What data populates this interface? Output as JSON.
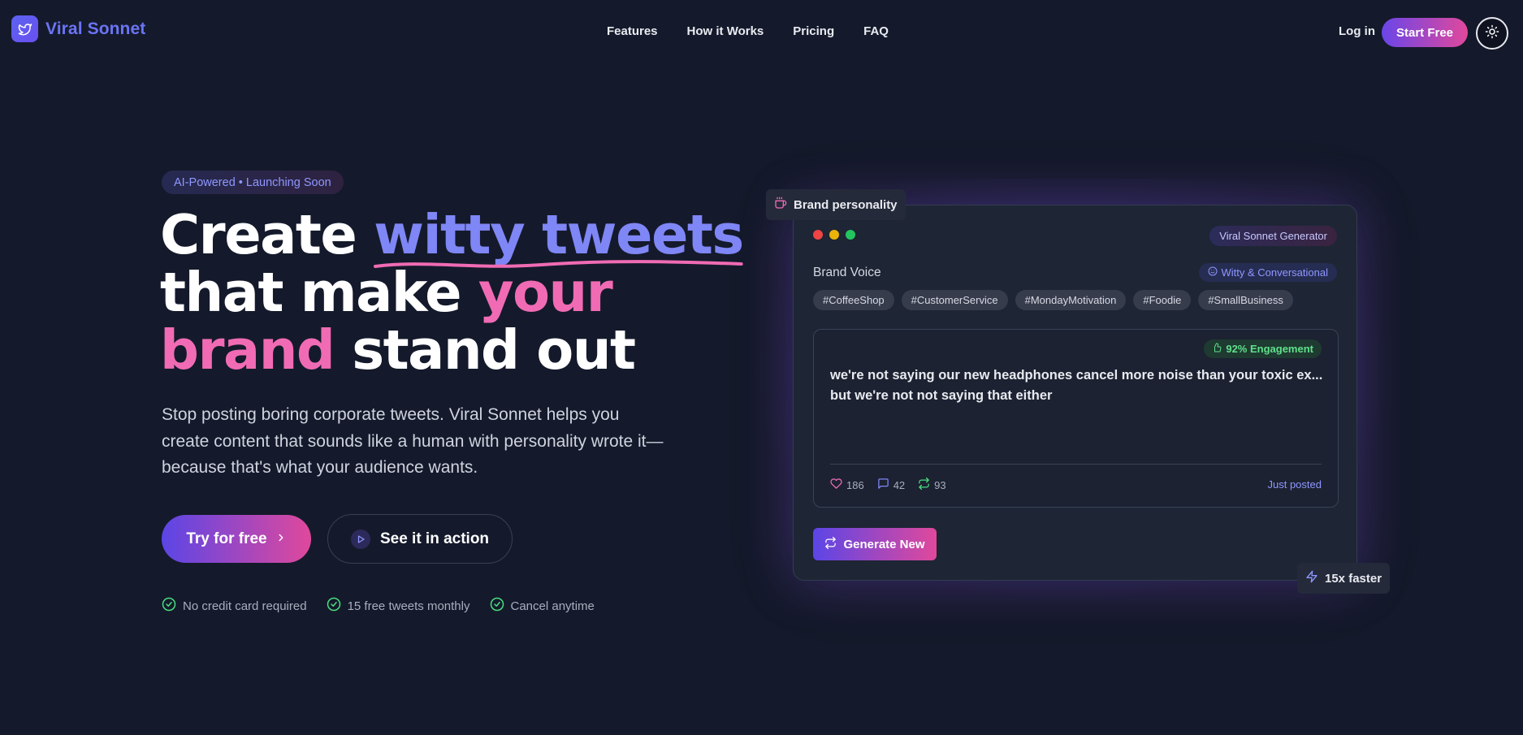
{
  "brand": {
    "name": "Viral Sonnet"
  },
  "nav": {
    "links": [
      "Features",
      "How it Works",
      "Pricing",
      "FAQ"
    ],
    "login": "Log in",
    "cta": "Start Free"
  },
  "hero": {
    "badge": "AI-Powered • Launching Soon",
    "headline": {
      "part1": "Create ",
      "highlight1": "witty tweets",
      "part2": "that make ",
      "highlight2a": "your",
      "highlight2b": "brand",
      "part3": " stand out"
    },
    "subtitle": "Stop posting boring corporate tweets. Viral Sonnet helps you create content that sounds like a human with personality wrote it—because that's what your audience wants.",
    "primary_cta": "Try for free",
    "secondary_cta": "See it in action",
    "checks": [
      "No credit card required",
      "15 free tweets monthly",
      "Cancel anytime"
    ]
  },
  "card": {
    "personality_label": "Brand personality",
    "generator_badge": "Viral Sonnet Generator",
    "brand_voice_label": "Brand Voice",
    "voice_tag": "Witty & Conversational",
    "hashtags": [
      "#CoffeeShop",
      "#CustomerService",
      "#MondayMotivation",
      "#Foodie",
      "#SmallBusiness"
    ],
    "engagement": "92% Engagement",
    "tweet_line1": "we're not saying our new headphones cancel more noise than your toxic ex...",
    "tweet_line2": "but we're not not saying that either",
    "likes": "186",
    "comments": "42",
    "retweets": "93",
    "posted": "Just posted",
    "generate_button": "Generate New",
    "speed_label": "15x faster"
  },
  "colors": {
    "background": "#141a2b",
    "accent_blue": "#7f86f5",
    "accent_pink": "#f06bb4",
    "success_green": "#5fe08b"
  }
}
